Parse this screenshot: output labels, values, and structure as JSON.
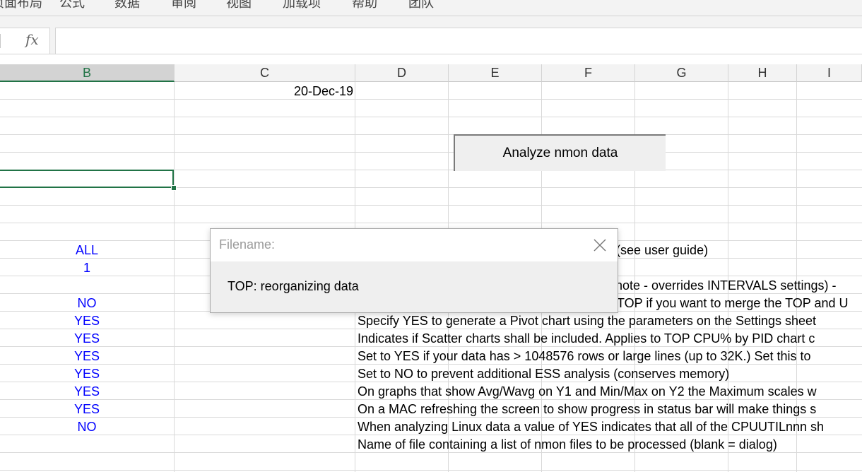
{
  "ribbon": {
    "tabs": [
      "页面布局",
      "公式",
      "数据",
      "审阅",
      "视图",
      "加载项",
      "帮助",
      "团队"
    ]
  },
  "formula_bar": {
    "fx_label": "fx",
    "value": ""
  },
  "columns": [
    "B",
    "C",
    "D",
    "E",
    "F",
    "G",
    "H",
    "I"
  ],
  "active_column": "B",
  "cells": {
    "c_date": "20-Dec-19",
    "b_values": [
      "ALL",
      "1",
      "NO",
      "YES",
      "YES",
      "YES",
      "YES",
      "YES",
      "YES",
      "NO"
    ],
    "d_texts": [
      "s (see user guide)",
      "note - overrides INTERVALS settings) -",
      "TOP if you want to merge the TOP and U",
      "Specify YES to generate a Pivot chart using the parameters on the Settings sheet",
      "Indicates if Scatter charts shall be included.  Applies to TOP CPU% by PID chart c",
      "Set to YES if your data has > 1048576 rows or large lines (up to 32K.)  Set this to",
      "Set to NO to prevent additional ESS analysis (conserves memory)",
      "On graphs that show Avg/Wavg on Y1 and Min/Max on Y2 the Maximum scales w",
      "On a MAC refreshing the screen to show progress in status bar will make things s",
      "When analyzing Linux data a value of YES indicates that all of the CPUUTILnnn sh",
      "Name of file containing a list of nmon files to be processed (blank = dialog)"
    ]
  },
  "analyze_button": {
    "label": "Analyze nmon data"
  },
  "dialog": {
    "title": "Filename:",
    "message": "TOP: reorganizing data",
    "close_icon": "close-icon"
  },
  "colors": {
    "excel_green": "#217346",
    "cell_blue": "#0000ff",
    "grid": "#d9d9d9",
    "chrome": "#f3f3f3"
  }
}
